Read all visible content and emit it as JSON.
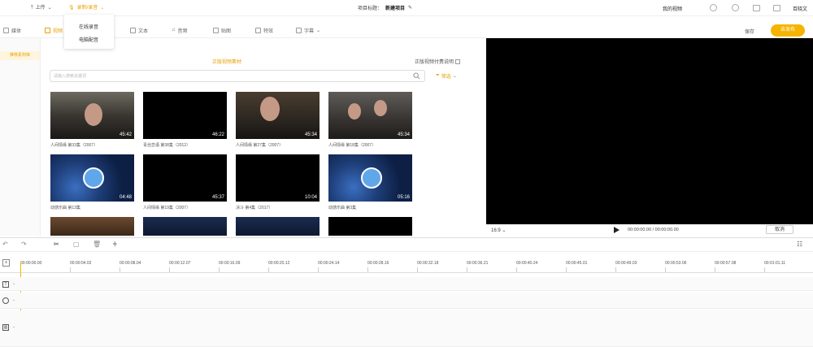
{
  "topbar": {
    "upload_label": "上传",
    "record_label": "录制/录音",
    "title_prefix": "项目标题：",
    "project_name": "新建项目",
    "my_videos": "我的视频",
    "user_name": "百晓文"
  },
  "dropdown": {
    "items": [
      "在线录音",
      "电脑配音"
    ]
  },
  "tabs": [
    "媒体",
    "视频",
    "文本",
    "音频",
    "贴图",
    "特效",
    "字幕"
  ],
  "actions": {
    "save_label": "保存",
    "publish_label": "去发布"
  },
  "sidebar": {
    "active_item": "推荐素材库"
  },
  "content": {
    "subtab": "正版视频素材",
    "vip_filter": "正版视频付费说明",
    "search_placeholder": "请输入搜索关键词",
    "filter_label": "筛选",
    "thumbnails": [
      {
        "duration": "45:42",
        "caption": "人间情缘 第33集（2007）"
      },
      {
        "duration": "46:22",
        "caption": "青丝恋语 第38集（2012）"
      },
      {
        "duration": "45:34",
        "caption": "人间情缘 第27集（2007）"
      },
      {
        "duration": "45:34",
        "caption": "人间情缘 第18集（2007）"
      },
      {
        "duration": "04:48",
        "caption": "动感乐曲 第13集"
      },
      {
        "duration": "45:37",
        "caption": "人间情缘 第19集（2007）"
      },
      {
        "duration": "10:04",
        "caption": "决斗 第4集（2017）"
      },
      {
        "duration": "05:16",
        "caption": "动感乐曲 第3集"
      }
    ]
  },
  "preview": {
    "ratio": "16:9",
    "timecode": "00:00:00.00 / 00:00:00.00",
    "snap_label": "取消"
  },
  "timeline": {
    "ticks": [
      "00:00:00.00",
      "00:00:04.02",
      "00:00:08.04",
      "00:00:12.07",
      "00:00:16.09",
      "00:00:20.12",
      "00:00:24.14",
      "00:00:28.16",
      "00:00:32.18",
      "00:00:36.21",
      "00:00:40.24",
      "00:00:45.01",
      "00:00:49.03",
      "00:00:53.06",
      "00:00:57.08",
      "00:01:01.11",
      "00:01:05"
    ]
  }
}
